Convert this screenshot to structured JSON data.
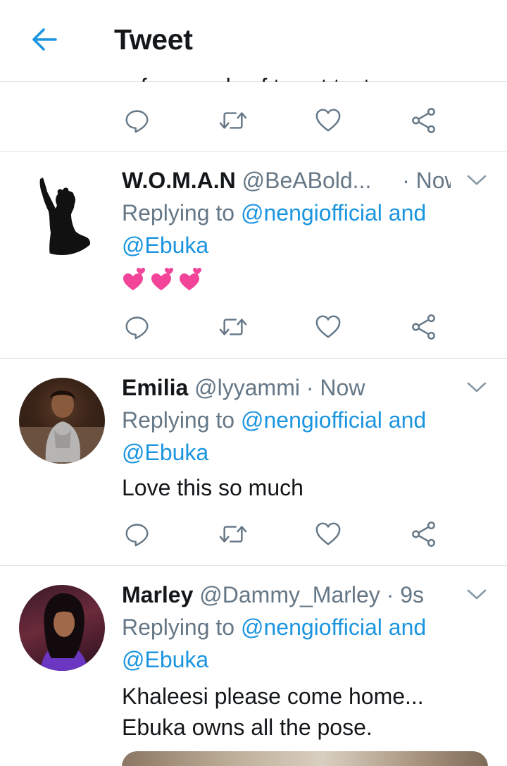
{
  "header": {
    "title": "Tweet"
  },
  "partial_tweet": {
    "text": "a few words of tweet text"
  },
  "tweets": [
    {
      "name": "W.O.M.A.N",
      "handle": "@BeABold...",
      "time": "· Now",
      "replying_prefix": "Replying to",
      "mention_line1": "@nengiofficial and",
      "mention_line2": "@Ebuka",
      "text": "💕💕💕"
    },
    {
      "name": "Emilia",
      "handle": "@lyyammi",
      "time": "· Now",
      "replying_prefix": "Replying to",
      "mention_line1": "@nengiofficial and",
      "mention_line2": "@Ebuka",
      "text": "Love this so much"
    },
    {
      "name": "Marley",
      "handle": "@Dammy_Marley",
      "time": "· 9s",
      "replying_prefix": "Replying to",
      "mention_line1": "@nengiofficial and",
      "mention_line2": "@Ebuka",
      "text_line1": "Khaleesi please come home...",
      "text_line2": "Ebuka owns all the pose."
    }
  ],
  "colors": {
    "accent": "#1b95e0",
    "secondary_text": "#657786",
    "divider": "#dfe4e8"
  },
  "icons": [
    "back-arrow-icon",
    "reply-icon",
    "retweet-icon",
    "like-icon",
    "share-icon",
    "chevron-down-icon"
  ]
}
